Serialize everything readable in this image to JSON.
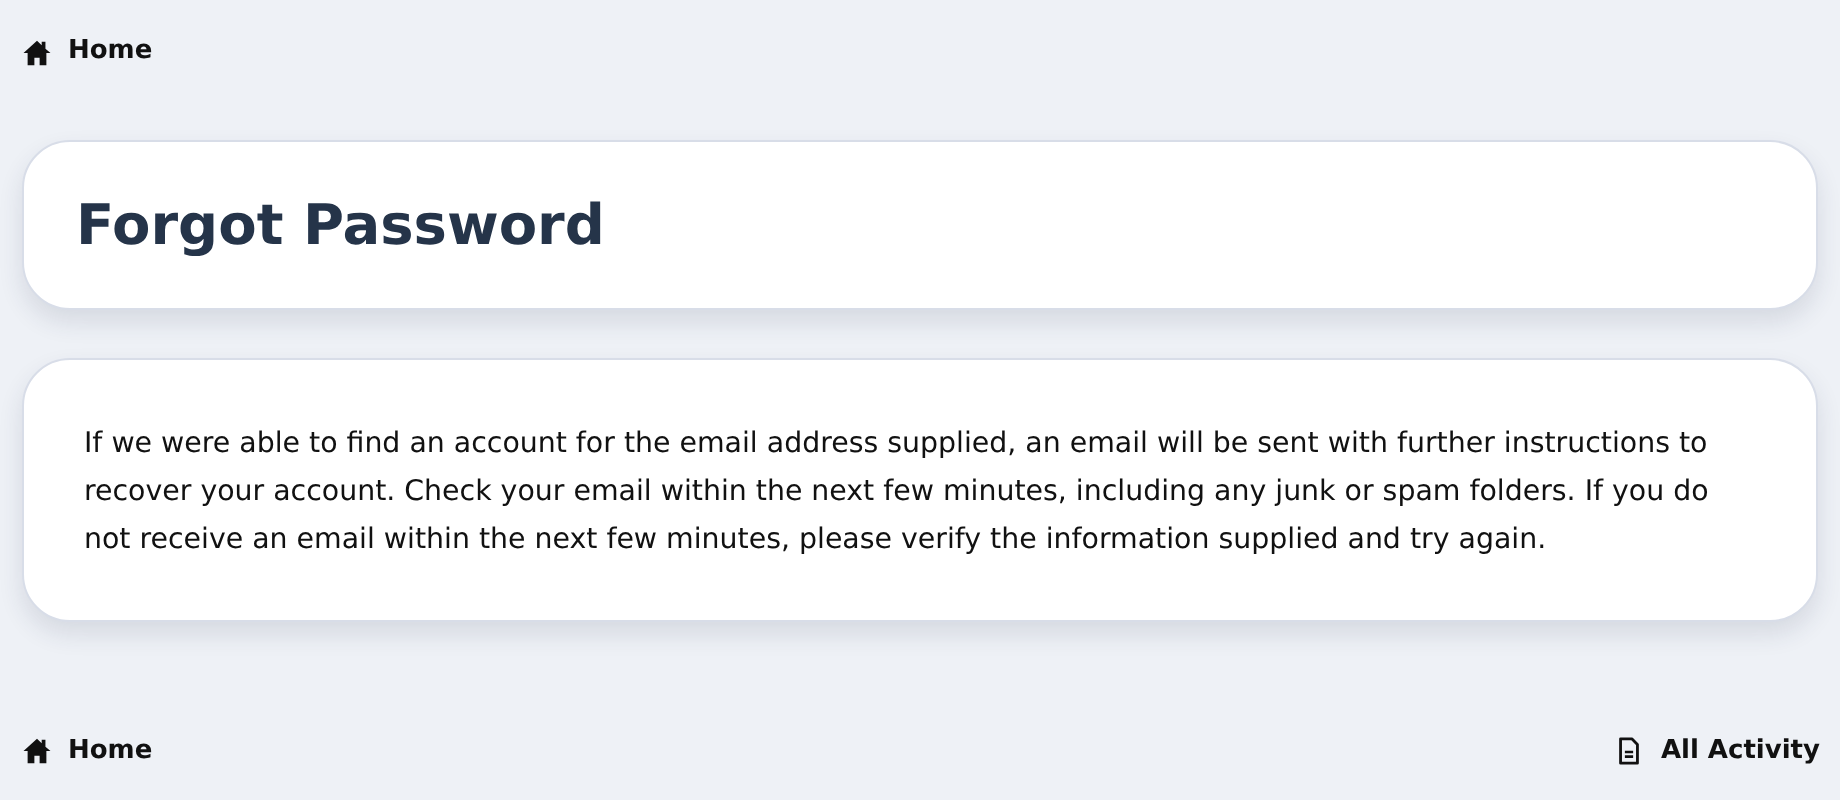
{
  "breadcrumb": [
    {
      "label": "Home",
      "kind": "home"
    }
  ],
  "header": {
    "title": "Forgot Password"
  },
  "message": {
    "text": "If we were able to find an account for the email address supplied, an email will be sent with further instructions to recover your account. Check your email within the next few minutes, including any junk or spam folders. If you do not receive an email within the next few minutes, please verify the information supplied and try again."
  },
  "footer": {
    "left": [
      {
        "label": "Home",
        "kind": "home"
      }
    ],
    "right": [
      {
        "label": "All Activity",
        "kind": "document"
      }
    ]
  }
}
